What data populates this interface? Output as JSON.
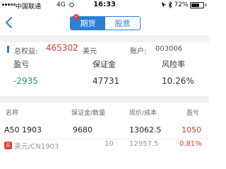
{
  "status_bar": {
    "carrier": "中国联通",
    "network": "4G",
    "time": "16:33",
    "battery_percent": "72%",
    "battery_level": 0.72
  },
  "header": {
    "tabs": [
      {
        "label": "期货",
        "active": true
      },
      {
        "label": "股票",
        "active": false
      }
    ]
  },
  "account": {
    "equity_label": "总权益:",
    "equity_value": "465302",
    "equity_unit": "美元",
    "account_label": "账户:",
    "account_value": "003006"
  },
  "summary": {
    "columns": [
      {
        "label": "盈亏",
        "value": "-2935"
      },
      {
        "label": "保证金",
        "value": "47731"
      },
      {
        "label": "风险率",
        "value": "10.26%"
      }
    ]
  },
  "table": {
    "headers": [
      "名称",
      "保证金/数量",
      "现价/成本",
      "盈亏"
    ],
    "rows": [
      {
        "name": "A50 1903",
        "sub_name": "美元/CN1903",
        "tag": "买",
        "margin": "9680",
        "quantity": "10",
        "price": "13062.5",
        "cost": "12957.5",
        "pnl": "1050",
        "pnl_pct": "0.81%"
      }
    ]
  },
  "colors": {
    "accent": "#2d7fd8",
    "up": "#e53935",
    "down": "#1aa35a"
  }
}
